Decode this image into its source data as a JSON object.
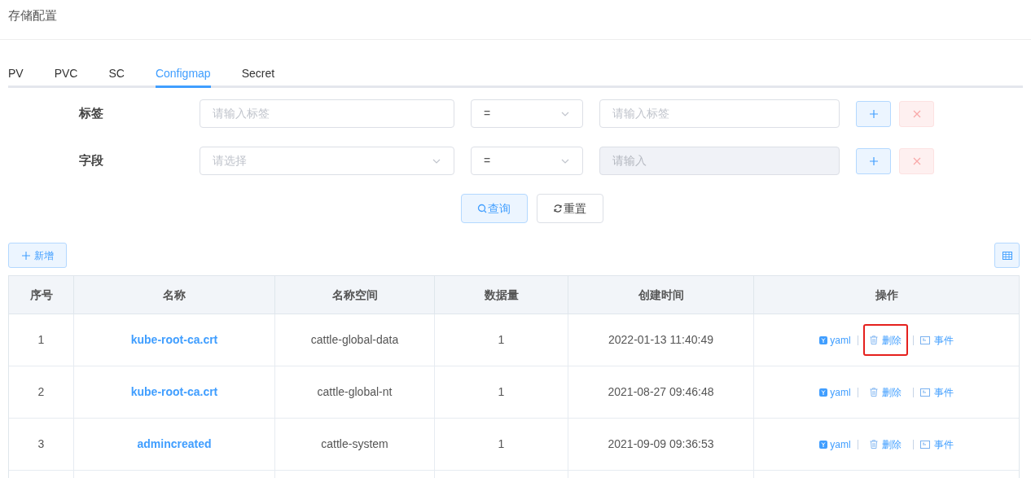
{
  "page_title": "存储配置",
  "tabs": [
    {
      "label": "PV",
      "selected": false
    },
    {
      "label": "PVC",
      "selected": false
    },
    {
      "label": "SC",
      "selected": false
    },
    {
      "label": "Configmap",
      "selected": true
    },
    {
      "label": "Secret",
      "selected": false
    }
  ],
  "filters": [
    {
      "label": "标签",
      "key_field": {
        "kind": "input",
        "placeholder": "请输入标签"
      },
      "operator": "=",
      "value_field": {
        "placeholder": "请输入标签",
        "disabled": false
      }
    },
    {
      "label": "字段",
      "key_field": {
        "kind": "select",
        "placeholder": "请选择"
      },
      "operator": "=",
      "value_field": {
        "placeholder": "请输入",
        "disabled": true
      }
    }
  ],
  "query_button": "查询",
  "reset_button": "重置",
  "add_button": "新增",
  "table": {
    "columns": [
      "序号",
      "名称",
      "名称空间",
      "数据量",
      "创建时间",
      "操作"
    ],
    "rows": [
      {
        "index": "1",
        "name": "kube-root-ca.crt",
        "namespace": "cattle-global-data",
        "data_count": "1",
        "created": "2022-01-13 11:40:49",
        "actions": {
          "yaml": "yaml",
          "delete": "删除",
          "events": "事件",
          "delete_highlighted": true
        }
      },
      {
        "index": "2",
        "name": "kube-root-ca.crt",
        "namespace": "cattle-global-nt",
        "data_count": "1",
        "created": "2021-08-27 09:46:48",
        "actions": {
          "yaml": "yaml",
          "delete": "删除",
          "events": "事件",
          "delete_highlighted": false
        }
      },
      {
        "index": "3",
        "name": "admincreated",
        "namespace": "cattle-system",
        "data_count": "1",
        "created": "2021-09-09 09:36:53",
        "actions": {
          "yaml": "yaml",
          "delete": "删除",
          "events": "事件",
          "delete_highlighted": false
        }
      }
    ]
  }
}
